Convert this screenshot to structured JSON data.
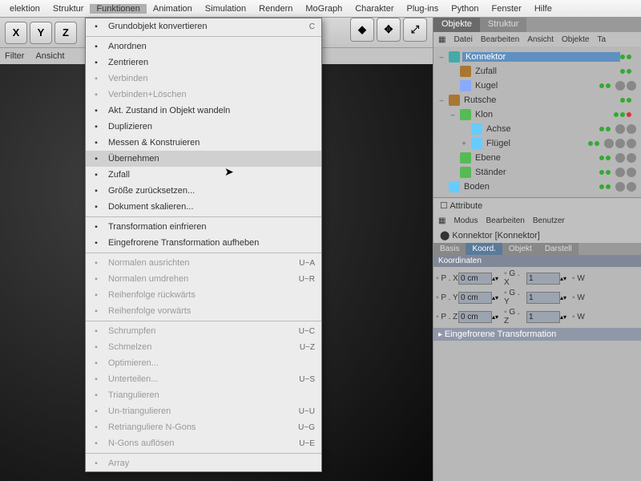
{
  "menubar": [
    "elektion",
    "Struktur",
    "Funktionen",
    "Animation",
    "Simulation",
    "Rendern",
    "MoGraph",
    "Charakter",
    "Plug-ins",
    "Python",
    "Fenster",
    "Hilfe"
  ],
  "menubar_active": 2,
  "toolbar_axes": [
    "X",
    "Y",
    "Z"
  ],
  "subtoolbar": [
    "Filter",
    "Ansicht"
  ],
  "dropdown": [
    {
      "label": "Grundobjekt konvertieren",
      "shortcut": "C"
    },
    {
      "sep": true
    },
    {
      "label": "Anordnen"
    },
    {
      "label": "Zentrieren"
    },
    {
      "label": "Verbinden",
      "disabled": true
    },
    {
      "label": "Verbinden+Löschen",
      "disabled": true
    },
    {
      "label": "Akt. Zustand in Objekt wandeln"
    },
    {
      "label": "Duplizieren"
    },
    {
      "label": "Messen & Konstruieren"
    },
    {
      "label": "Übernehmen",
      "hover": true
    },
    {
      "label": "Zufall"
    },
    {
      "label": "Größe zurücksetzen..."
    },
    {
      "label": "Dokument skalieren..."
    },
    {
      "sep": true
    },
    {
      "label": "Transformation einfrieren"
    },
    {
      "label": "Eingefrorene Transformation aufheben"
    },
    {
      "sep": true
    },
    {
      "label": "Normalen ausrichten",
      "shortcut": "U~A",
      "disabled": true
    },
    {
      "label": "Normalen umdrehen",
      "shortcut": "U~R",
      "disabled": true
    },
    {
      "label": "Reihenfolge rückwärts",
      "disabled": true
    },
    {
      "label": "Reihenfolge vorwärts",
      "disabled": true
    },
    {
      "sep": true
    },
    {
      "label": "Schrumpfen",
      "shortcut": "U~C",
      "disabled": true
    },
    {
      "label": "Schmelzen",
      "shortcut": "U~Z",
      "disabled": true
    },
    {
      "label": "Optimieren...",
      "disabled": true
    },
    {
      "label": "Unterteilen...",
      "shortcut": "U~S",
      "disabled": true
    },
    {
      "label": "Triangulieren",
      "disabled": true
    },
    {
      "label": "Un-triangulieren",
      "shortcut": "U~U",
      "disabled": true
    },
    {
      "label": "Retrianguliere N-Gons",
      "shortcut": "U~G",
      "disabled": true
    },
    {
      "label": "N-Gons auflösen",
      "shortcut": "U~E",
      "disabled": true
    },
    {
      "sep": true
    },
    {
      "label": "Array",
      "disabled": true
    }
  ],
  "objpanel": {
    "tabs": [
      "Objekte",
      "Struktur"
    ],
    "active": 0,
    "menu": [
      "Datei",
      "Bearbeiten",
      "Ansicht",
      "Objekte",
      "Ta"
    ],
    "tree": [
      {
        "depth": 0,
        "exp": "–",
        "icon": "#4aa",
        "name": "Konnektor",
        "sel": true
      },
      {
        "depth": 1,
        "exp": "",
        "icon": "#a73",
        "name": "Zufall"
      },
      {
        "depth": 1,
        "exp": "",
        "icon": "#8af",
        "name": "Kugel",
        "tags": 2
      },
      {
        "depth": 0,
        "exp": "–",
        "icon": "#a73",
        "name": "Rutsche"
      },
      {
        "depth": 1,
        "exp": "–",
        "icon": "#5b5",
        "name": "Klon",
        "red": true
      },
      {
        "depth": 2,
        "exp": "",
        "icon": "#6cf",
        "name": "Achse",
        "tags": 2
      },
      {
        "depth": 2,
        "exp": "+",
        "icon": "#6cf",
        "name": "Flügel",
        "tags": 3
      },
      {
        "depth": 1,
        "exp": "",
        "icon": "#5b5",
        "name": "Ebene",
        "tags": 2
      },
      {
        "depth": 1,
        "exp": "",
        "icon": "#5b5",
        "name": "Ständer",
        "tags": 2
      },
      {
        "depth": 0,
        "exp": "",
        "icon": "#6cf",
        "name": "Boden",
        "tags": 2
      }
    ]
  },
  "attr": {
    "title": "Attribute",
    "menu": [
      "Modus",
      "Bearbeiten",
      "Benutzer"
    ],
    "objname": "Konnektor [Konnektor]",
    "tabs": [
      "Basis",
      "Koord.",
      "Objekt",
      "Darstell"
    ],
    "active": 1,
    "section": "Koordinaten",
    "coords": [
      {
        "l": "P . X",
        "v": "0 cm"
      },
      {
        "l": "G . X",
        "v": "1"
      },
      {
        "l": "W"
      },
      {
        "l": "P . Y",
        "v": "0 cm"
      },
      {
        "l": "G . Y",
        "v": "1"
      },
      {
        "l": "W"
      },
      {
        "l": "P . Z",
        "v": "0 cm"
      },
      {
        "l": "G . Z",
        "v": "1"
      },
      {
        "l": "W"
      }
    ],
    "frozen": "Eingefrorene Transformation"
  }
}
